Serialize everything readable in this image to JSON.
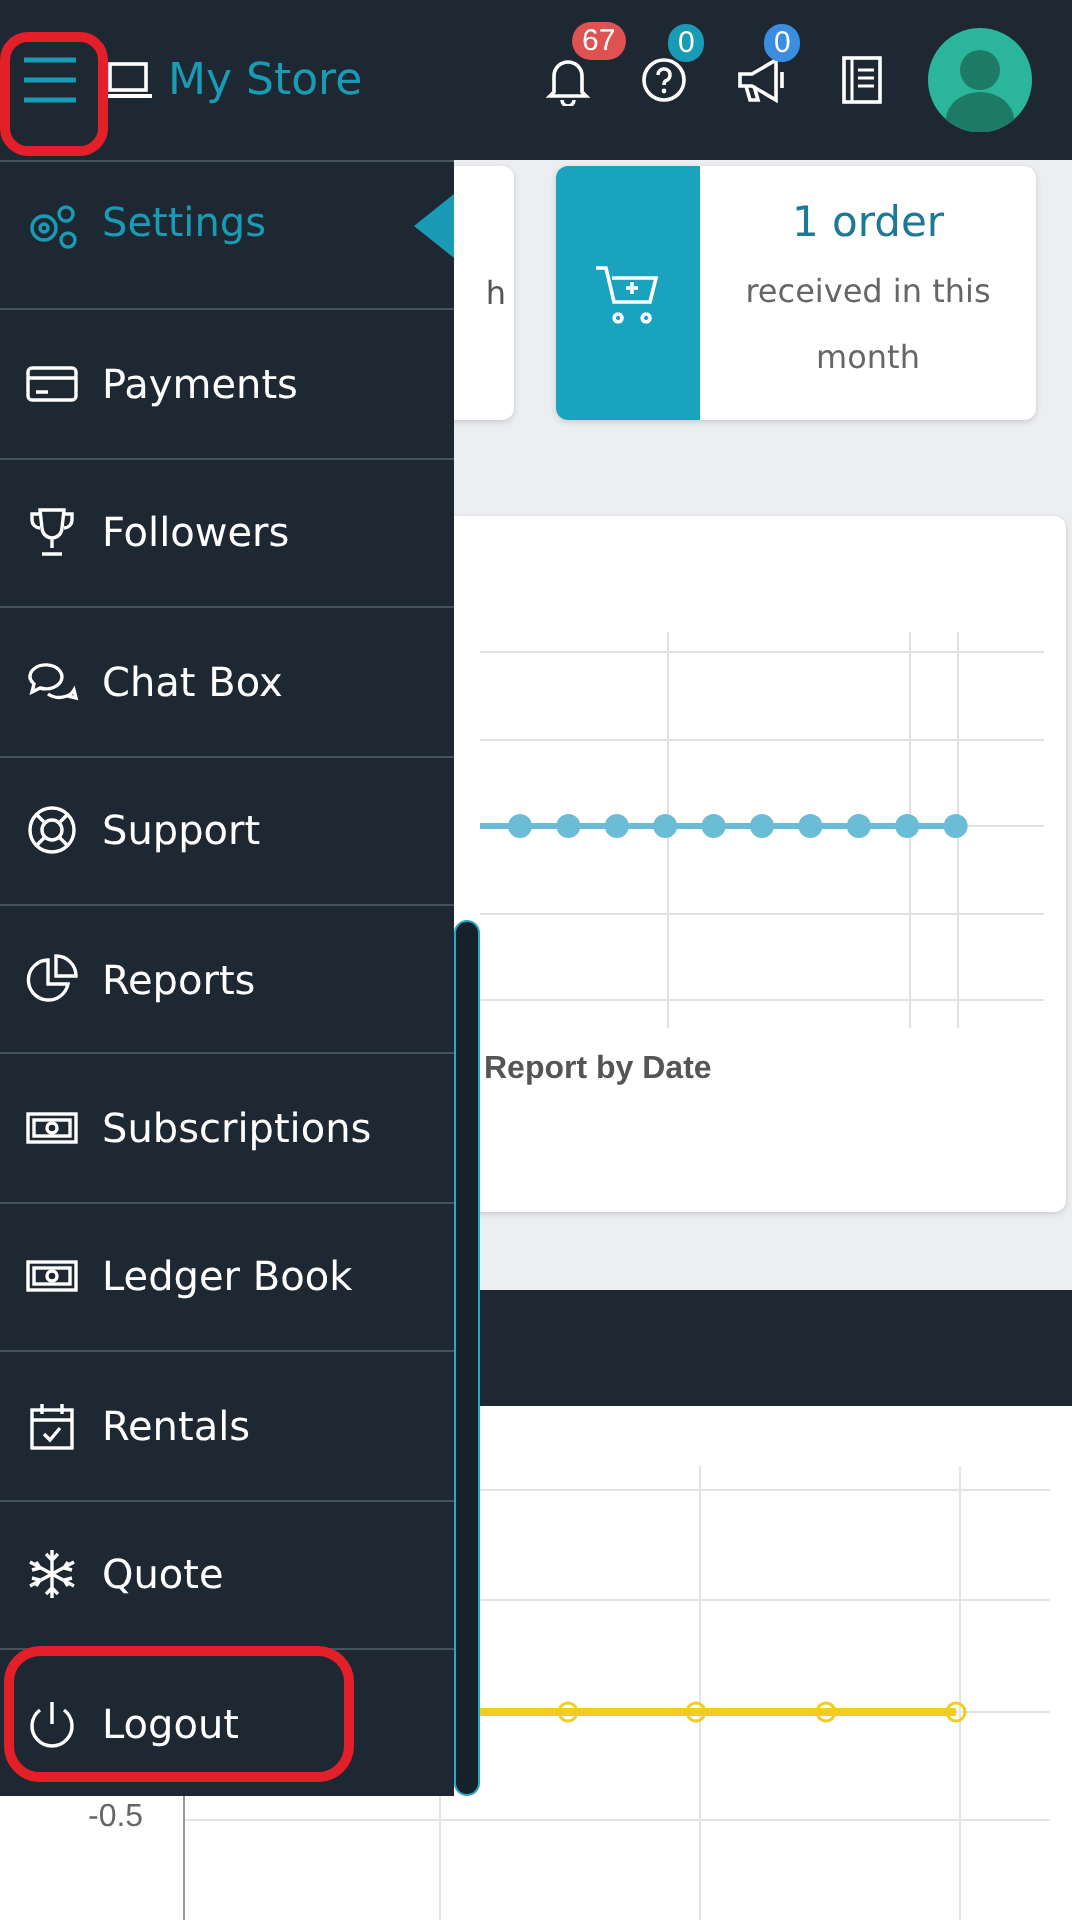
{
  "header": {
    "menu_button": {
      "highlighted": true
    },
    "store_name": "My Store",
    "badges": [
      {
        "count": "67",
        "color": "#e05252"
      },
      {
        "count": "0",
        "color": "#1a9bb5"
      },
      {
        "count": "0",
        "color": "#3b8de0"
      }
    ]
  },
  "sidebar": {
    "items": [
      {
        "label": "Settings",
        "selected": true,
        "highlighted": false
      },
      {
        "label": "Payments",
        "selected": false,
        "highlighted": false
      },
      {
        "label": "Followers",
        "selected": false,
        "highlighted": false
      },
      {
        "label": "Chat Box",
        "selected": false,
        "highlighted": false
      },
      {
        "label": "Support",
        "selected": false,
        "highlighted": false
      },
      {
        "label": "Reports",
        "selected": false,
        "highlighted": false
      },
      {
        "label": "Subscriptions",
        "selected": false,
        "highlighted": false
      },
      {
        "label": "Ledger Book",
        "selected": false,
        "highlighted": false
      },
      {
        "label": "Rentals",
        "selected": false,
        "highlighted": false
      },
      {
        "label": "Quote",
        "selected": false,
        "highlighted": false
      },
      {
        "label": "Logout",
        "selected": false,
        "highlighted": true
      }
    ]
  },
  "summary_cards": [
    {
      "text": "h"
    },
    {
      "title": "1 order",
      "subtitle": "received in this month"
    }
  ],
  "sales_chart": {
    "legend": "Report by Date"
  },
  "lower_chart": {
    "y_tick_label": "-0.5"
  }
}
